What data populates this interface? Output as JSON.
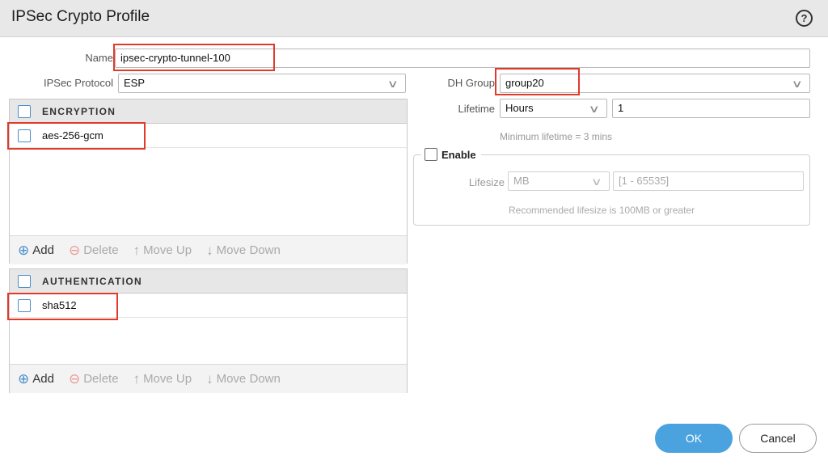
{
  "dialog": {
    "title": "IPSec Crypto Profile",
    "help_icon": "question-circle-icon",
    "help_glyph": "?"
  },
  "form": {
    "name_label": "Name",
    "name_value": "ipsec-crypto-tunnel-100",
    "protocol_label": "IPSec Protocol",
    "protocol_value": "ESP",
    "dh_group_label": "DH Group",
    "dh_group_value": "group20",
    "lifetime_label": "Lifetime",
    "lifetime_unit": "Hours",
    "lifetime_value": "1",
    "lifetime_hint": "Minimum lifetime = 3 mins",
    "enable_label": "Enable",
    "lifesize_label": "Lifesize",
    "lifesize_unit": "MB",
    "lifesize_placeholder": "[1 - 65535]",
    "lifesize_hint": "Recommended lifesize is 100MB or greater"
  },
  "encryption": {
    "header": "ENCRYPTION",
    "items": [
      "aes-256-gcm"
    ]
  },
  "authentication": {
    "header": "AUTHENTICATION",
    "items": [
      "sha512"
    ]
  },
  "toolbar": {
    "add": "Add",
    "delete": "Delete",
    "move_up": "Move Up",
    "move_down": "Move Down",
    "add_glyph": "⊕",
    "delete_glyph": "⊖",
    "up_glyph": "↑",
    "down_glyph": "↓"
  },
  "buttons": {
    "ok": "OK",
    "cancel": "Cancel"
  },
  "colors": {
    "highlight": "#e03a2b",
    "accent": "#4aa3df"
  }
}
